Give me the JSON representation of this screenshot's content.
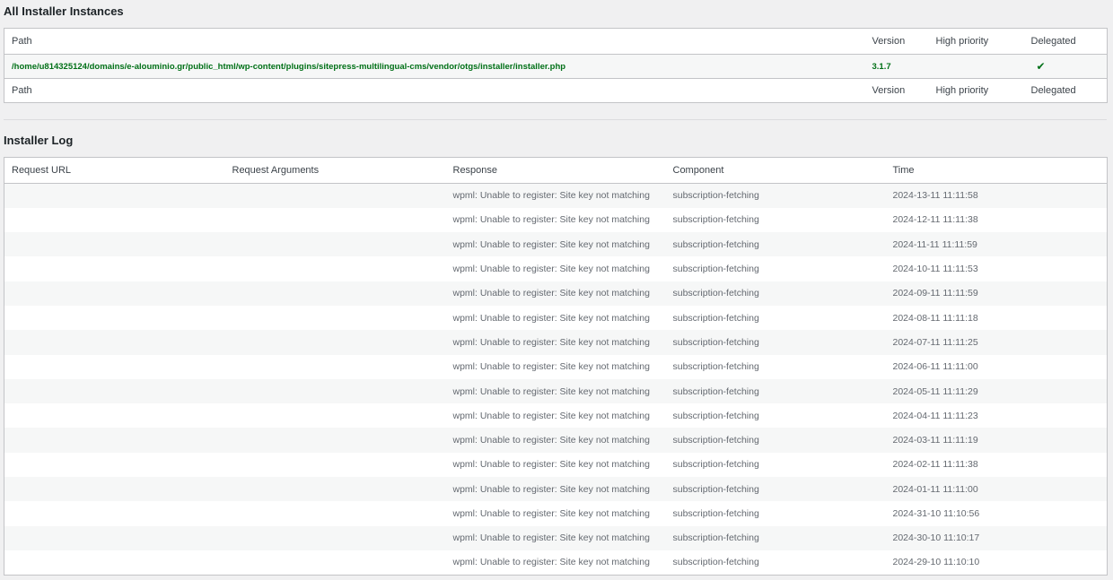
{
  "instances": {
    "title": "All Installer Instances",
    "columns": {
      "path": "Path",
      "version": "Version",
      "high_priority": "High priority",
      "delegated": "Delegated"
    },
    "row": {
      "path": "/home/u814325124/domains/e-alouminio.gr/public_html/wp-content/plugins/sitepress-multilingual-cms/vendor/otgs/installer/installer.php",
      "version": "3.1.7",
      "high_priority": "",
      "delegated": "✔"
    }
  },
  "log": {
    "title": "Installer Log",
    "columns": {
      "request_url": "Request URL",
      "request_arguments": "Request Arguments",
      "response": "Response",
      "component": "Component",
      "time": "Time"
    },
    "rows": [
      {
        "url": "",
        "args": "",
        "response": "wpml: Unable to register: Site key not matching",
        "component": "subscription-fetching",
        "time": "2024-13-11 11:11:58"
      },
      {
        "url": "",
        "args": "",
        "response": "wpml: Unable to register: Site key not matching",
        "component": "subscription-fetching",
        "time": "2024-12-11 11:11:38"
      },
      {
        "url": "",
        "args": "",
        "response": "wpml: Unable to register: Site key not matching",
        "component": "subscription-fetching",
        "time": "2024-11-11 11:11:59"
      },
      {
        "url": "",
        "args": "",
        "response": "wpml: Unable to register: Site key not matching",
        "component": "subscription-fetching",
        "time": "2024-10-11 11:11:53"
      },
      {
        "url": "",
        "args": "",
        "response": "wpml: Unable to register: Site key not matching",
        "component": "subscription-fetching",
        "time": "2024-09-11 11:11:59"
      },
      {
        "url": "",
        "args": "",
        "response": "wpml: Unable to register: Site key not matching",
        "component": "subscription-fetching",
        "time": "2024-08-11 11:11:18"
      },
      {
        "url": "",
        "args": "",
        "response": "wpml: Unable to register: Site key not matching",
        "component": "subscription-fetching",
        "time": "2024-07-11 11:11:25"
      },
      {
        "url": "",
        "args": "",
        "response": "wpml: Unable to register: Site key not matching",
        "component": "subscription-fetching",
        "time": "2024-06-11 11:11:00"
      },
      {
        "url": "",
        "args": "",
        "response": "wpml: Unable to register: Site key not matching",
        "component": "subscription-fetching",
        "time": "2024-05-11 11:11:29"
      },
      {
        "url": "",
        "args": "",
        "response": "wpml: Unable to register: Site key not matching",
        "component": "subscription-fetching",
        "time": "2024-04-11 11:11:23"
      },
      {
        "url": "",
        "args": "",
        "response": "wpml: Unable to register: Site key not matching",
        "component": "subscription-fetching",
        "time": "2024-03-11 11:11:19"
      },
      {
        "url": "",
        "args": "",
        "response": "wpml: Unable to register: Site key not matching",
        "component": "subscription-fetching",
        "time": "2024-02-11 11:11:38"
      },
      {
        "url": "",
        "args": "",
        "response": "wpml: Unable to register: Site key not matching",
        "component": "subscription-fetching",
        "time": "2024-01-11 11:11:00"
      },
      {
        "url": "",
        "args": "",
        "response": "wpml: Unable to register: Site key not matching",
        "component": "subscription-fetching",
        "time": "2024-31-10 11:10:56"
      },
      {
        "url": "",
        "args": "",
        "response": "wpml: Unable to register: Site key not matching",
        "component": "subscription-fetching",
        "time": "2024-30-10 11:10:17"
      },
      {
        "url": "",
        "args": "",
        "response": "wpml: Unable to register: Site key not matching",
        "component": "subscription-fetching",
        "time": "2024-29-10 11:10:10"
      }
    ]
  }
}
